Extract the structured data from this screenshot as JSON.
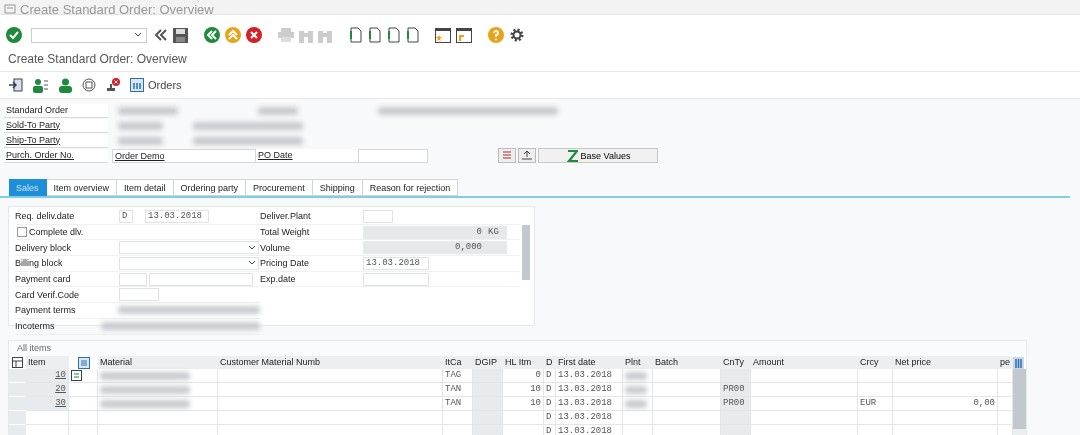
{
  "window": {
    "title": "Create Standard Order: Overview"
  },
  "screen_title": "Create Standard Order: Overview",
  "app_toolbar": {
    "orders_button": "Orders"
  },
  "header": {
    "standard_order_label": "Standard Order",
    "sold_to_label": "Sold-To Party",
    "ship_to_label": "Ship-To Party",
    "purch_order_label": "Purch. Order No.",
    "purch_order_value": "Order Demo",
    "po_date_label": "PO Date",
    "base_values_button": "Base Values"
  },
  "tabs": [
    {
      "label": "Sales",
      "selected": true
    },
    {
      "label": "Item overview",
      "selected": false
    },
    {
      "label": "Item detail",
      "selected": false
    },
    {
      "label": "Ordering party",
      "selected": false
    },
    {
      "label": "Procurement",
      "selected": false
    },
    {
      "label": "Shipping",
      "selected": false
    },
    {
      "label": "Reason for rejection",
      "selected": false
    }
  ],
  "sales": {
    "req_deliv_date": {
      "label": "Req. deliv.date",
      "unit": "D",
      "value": "13.03.2018"
    },
    "complete_dlv": {
      "label": "Complete dlv.",
      "checked": false
    },
    "delivery_block": {
      "label": "Delivery block"
    },
    "billing_block": {
      "label": "Billing block"
    },
    "payment_card": {
      "label": "Payment card"
    },
    "card_verif_code": {
      "label": "Card Verif.Code"
    },
    "payment_terms": {
      "label": "Payment terms"
    },
    "incoterms": {
      "label": "Incoterms"
    },
    "deliver_plant": {
      "label": "Deliver.Plant"
    },
    "total_weight": {
      "label": "Total Weight",
      "value": "0",
      "unit": "KG"
    },
    "volume": {
      "label": "Volume",
      "value": "0,000"
    },
    "pricing_date": {
      "label": "Pricing Date",
      "value": "13.03.2018"
    },
    "exp_date": {
      "label": "Exp.date"
    }
  },
  "items": {
    "title": "All items",
    "columns": [
      "Item",
      "Material",
      "Customer Material Numb",
      "ItCa",
      "DGIP",
      "HL Itm",
      "D",
      "First date",
      "Plnt",
      "Batch",
      "CnTy",
      "Amount",
      "Crcy",
      "Net price",
      "pe"
    ],
    "rows": [
      {
        "item": "10",
        "marked": true,
        "itca": "TAG",
        "hl_itm": "0",
        "d": "D",
        "first_date": "13.03.2018"
      },
      {
        "item": "20",
        "marked": false,
        "itca": "TAN",
        "hl_itm": "10",
        "d": "D",
        "first_date": "13.03.2018",
        "cnty": "PR00"
      },
      {
        "item": "30",
        "marked": false,
        "itca": "TAN",
        "hl_itm": "10",
        "d": "D",
        "first_date": "13.03.2018",
        "cnty": "PR00",
        "crcy": "EUR",
        "net_price": "0,00"
      },
      {
        "marked": false,
        "d": "D",
        "first_date": "13.03.2018"
      },
      {
        "marked": false,
        "d": "D",
        "first_date": "13.03.2018"
      }
    ]
  }
}
